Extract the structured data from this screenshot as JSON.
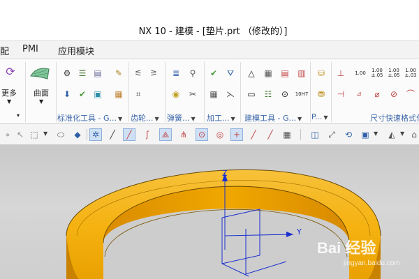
{
  "window": {
    "title": "NX 10 - 建模 - [垫片.prt （修改的）]"
  },
  "menubar": {
    "partial": "配",
    "items": [
      "PMI",
      "应用模块"
    ]
  },
  "ribbon": {
    "more_label": "更多",
    "surface_label": "曲面",
    "groups": [
      "标准化工具 - G...",
      "齿轮...",
      "弹簧...",
      "加工...",
      "建模工具 - G...",
      "P...",
      "尺寸快速格式化"
    ],
    "tolerance_values": {
      "single": "1.00",
      "pm_top": "1.00",
      "pm_bottom": "±.05",
      "limit_top": "1.00",
      "limit_bottom": "±.05",
      "fit_top": "1.00",
      "fit_bottom": "±.03"
    },
    "fit_label": "10H7"
  },
  "viewport": {
    "axes": {
      "z": "Z",
      "y": "Y"
    },
    "ring_color": "#f5b210"
  },
  "watermark": {
    "main": "Bai 经验",
    "sub": "jingyan.baidu.com"
  }
}
